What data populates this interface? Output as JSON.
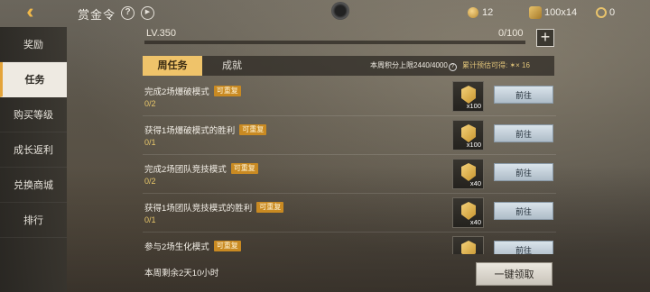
{
  "header": {
    "title": "赏金令",
    "currencies": [
      {
        "icon": "coin-icon",
        "value": "12"
      },
      {
        "icon": "ticket-icon",
        "value": "100x14"
      },
      {
        "icon": "key-icon",
        "value": "0"
      }
    ]
  },
  "sidebar": {
    "items": [
      {
        "label": "奖励",
        "active": false
      },
      {
        "label": "任务",
        "active": true
      },
      {
        "label": "购买等级",
        "active": false
      },
      {
        "label": "成长返利",
        "active": false
      },
      {
        "label": "兑换商城",
        "active": false
      },
      {
        "label": "排行",
        "active": false
      }
    ]
  },
  "level": {
    "label": "LV.350",
    "progress_text": "0/100",
    "progress": 0.0,
    "plus": "+"
  },
  "tabs": [
    {
      "label": "周任务",
      "active": true
    },
    {
      "label": "成就",
      "active": false
    }
  ],
  "weekly_cap": "本周积分上限2440/4000",
  "weekly_cap_help": "?",
  "estimate": "累计预估可得: ✶× 16",
  "tasks": [
    {
      "title": "完成2场爆破模式",
      "badge": "可重复",
      "progress": "0/2",
      "reward_count": "x100",
      "button": "前往"
    },
    {
      "title": "获得1场爆破模式的胜利",
      "badge": "可重复",
      "progress": "0/1",
      "reward_count": "x100",
      "button": "前往"
    },
    {
      "title": "完成2场团队竞技模式",
      "badge": "可重复",
      "progress": "0/2",
      "reward_count": "x40",
      "button": "前往"
    },
    {
      "title": "获得1场团队竞技模式的胜利",
      "badge": "可重复",
      "progress": "0/1",
      "reward_count": "x40",
      "button": "前往"
    },
    {
      "title": "参与2场生化模式",
      "badge": "可重复",
      "progress": "",
      "reward_count": "",
      "button": "前往"
    }
  ],
  "footer": {
    "remaining": "本周剩余2天10小时",
    "claim_all": "一键领取"
  },
  "colors": {
    "accent": "#efc36a",
    "badge": "#c98a22",
    "progress_text": "#e8c76a"
  }
}
